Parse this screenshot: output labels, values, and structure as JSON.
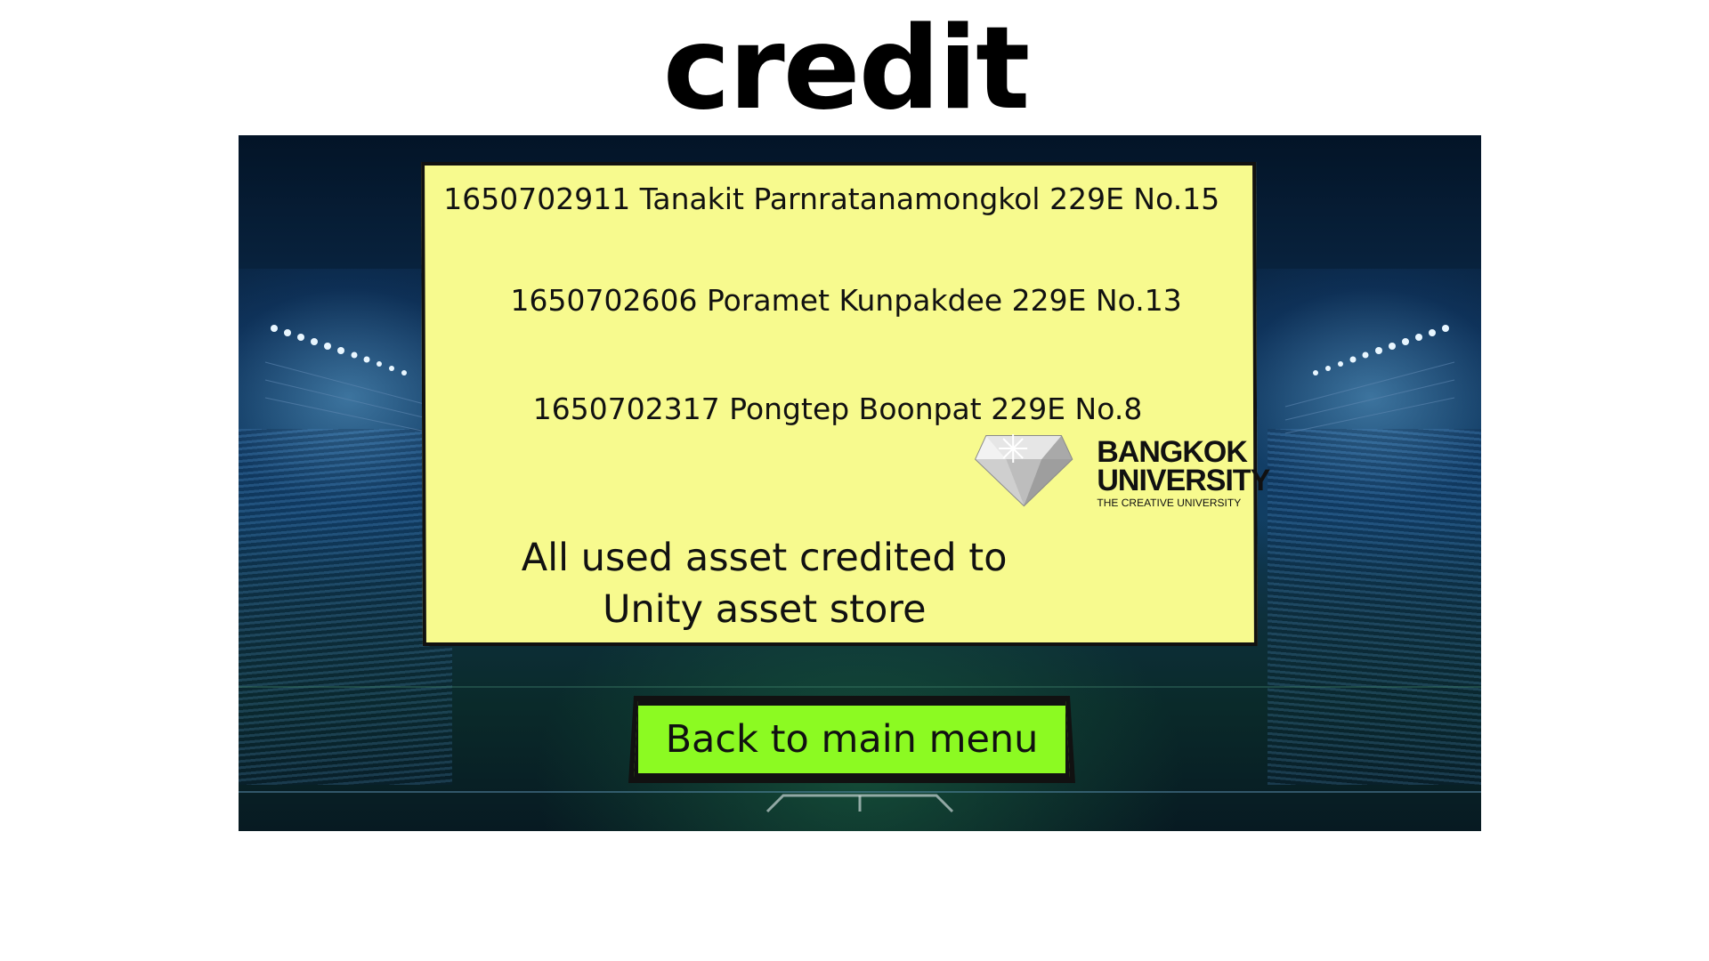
{
  "page": {
    "title": "credit"
  },
  "credits": {
    "members": [
      "1650702911 Tanakit Parnratanamongkol 229E No.15",
      "1650702606 Poramet Kunpakdee 229E No.13",
      "1650702317 Pongtep Boonpat 229E No.8"
    ],
    "asset_note_line1": "All used asset credited to",
    "asset_note_line2": "Unity asset store"
  },
  "logo": {
    "name_line1": "BANGKOK",
    "name_line2": "UNIVERSITY",
    "tagline": "THE CREATIVE UNIVERSITY"
  },
  "buttons": {
    "back_label": "Back to main menu"
  },
  "colors": {
    "card_background": "#f7fa8e",
    "button_background": "#8cfa22",
    "background_theme": "stadium-night"
  }
}
